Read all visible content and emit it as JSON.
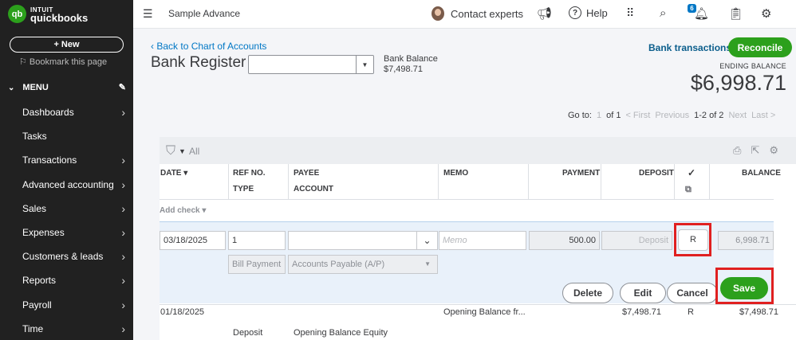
{
  "sidebar": {
    "logo": {
      "badge": "qb",
      "line1": "INTUIT",
      "line2": "quickbooks"
    },
    "new_label": "+ New",
    "bookmark_label": "Bookmark this page",
    "menu_label": "MENU",
    "items": [
      {
        "label": "Dashboards"
      },
      {
        "label": "Tasks"
      },
      {
        "label": "Transactions"
      },
      {
        "label": "Advanced accounting"
      },
      {
        "label": "Sales"
      },
      {
        "label": "Expenses"
      },
      {
        "label": "Customers & leads"
      },
      {
        "label": "Reports"
      },
      {
        "label": "Payroll"
      },
      {
        "label": "Time"
      }
    ]
  },
  "topbar": {
    "company": "Sample Advance",
    "contact_label": "Contact experts",
    "help_label": "Help",
    "notification_count": "6"
  },
  "header": {
    "back_link": "Back to Chart of Accounts",
    "title": "Bank Register",
    "bank_balance_label": "Bank Balance",
    "bank_balance_value": "$7,498.71",
    "bank_transactions_link": "Bank transactions",
    "reconcile_label": "Reconcile",
    "ending_balance_label": "ENDING BALANCE",
    "ending_balance_value": "$6,998.71"
  },
  "pager": {
    "goto_label": "Go to:",
    "page_input": "1",
    "of_label": "of 1",
    "first": "< First",
    "previous": "Previous",
    "range": "1-2 of 2",
    "next": "Next",
    "last": "Last >"
  },
  "register": {
    "filter_label": "All",
    "columns": {
      "date": "DATE ▾",
      "ref": "REF NO.",
      "type": "TYPE",
      "payee": "PAYEE",
      "account": "ACCOUNT",
      "memo": "MEMO",
      "payment": "PAYMENT",
      "deposit": "DEPOSIT",
      "cleared": "✓",
      "balance": "BALANCE"
    },
    "add_check_label": "Add check",
    "edit_row": {
      "date": "03/18/2025",
      "ref": "1",
      "payee": "",
      "memo_placeholder": "Memo",
      "payment": "500.00",
      "deposit_placeholder": "Deposit",
      "cleared": "R",
      "balance": "6,998.71",
      "type": "Bill Payment",
      "account": "Accounts Payable (A/P)"
    },
    "buttons": {
      "delete": "Delete",
      "edit": "Edit",
      "cancel": "Cancel",
      "save": "Save"
    },
    "rows": [
      {
        "date": "01/18/2025",
        "memo": "Opening Balance fr...",
        "deposit": "$7,498.71",
        "cleared": "R",
        "balance": "$7,498.71",
        "type": "Deposit",
        "account": "Opening Balance Equity"
      }
    ]
  }
}
